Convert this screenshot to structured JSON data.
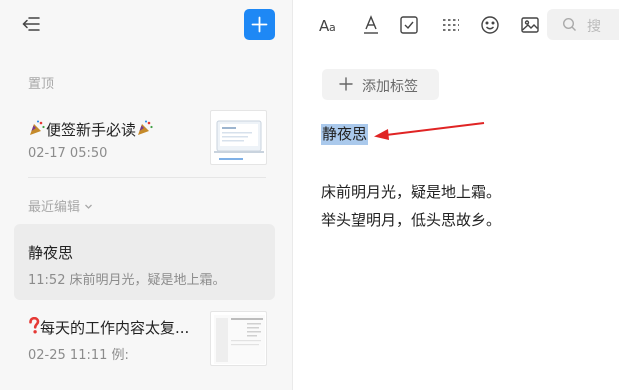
{
  "sidebar": {
    "pinned_label": "置顶",
    "recent_label": "最近编辑",
    "notes": [
      {
        "title": "便签新手必读",
        "date": "02-17",
        "time": "05:50",
        "preview": ""
      },
      {
        "title": "静夜思",
        "date": "",
        "time": "11:52",
        "preview": "床前明月光，疑是地上霜。"
      },
      {
        "title": "每天的工作内容太复...",
        "date": "02-25",
        "time": "11:11",
        "preview": "例:"
      }
    ]
  },
  "editor": {
    "search_placeholder": "搜",
    "add_tag_label": "添加标签",
    "doc_title": "静夜思",
    "lines": [
      "床前明月光，疑是地上霜。",
      "举头望明月，低头思故乡。"
    ]
  },
  "colors": {
    "accent": "#1e88f5",
    "selection": "#aac9ec",
    "annotation_arrow": "#e02424"
  },
  "icons": [
    "collapse-sidebar-icon",
    "plus-icon",
    "font-size-icon",
    "text-color-icon",
    "checkbox-icon",
    "divider-icon",
    "emoji-icon",
    "image-icon",
    "search-icon",
    "party-popper-icon",
    "question-mark-icon",
    "chevron-down-icon"
  ]
}
